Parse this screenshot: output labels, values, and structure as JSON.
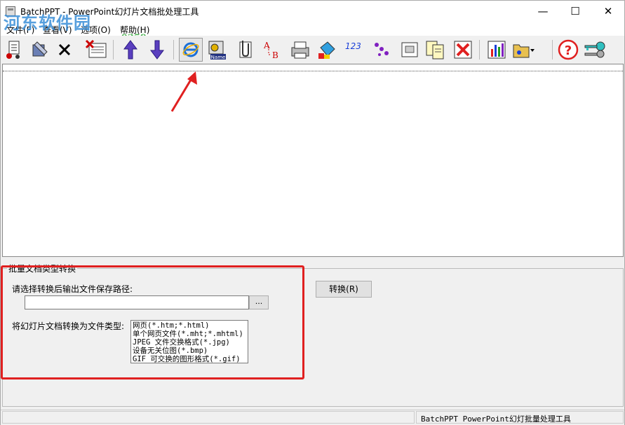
{
  "window": {
    "title": "BatchPPT - PowerPoint幻灯片文档批处理工具",
    "min_glyph": "—",
    "max_glyph": "☐",
    "close_glyph": "✕"
  },
  "watermark": {
    "text": "河东软件园",
    "url": "www.pc0359.cn"
  },
  "menu": {
    "items": [
      "文件(F)",
      "查看(V)",
      "选项(O)",
      "帮助(H)"
    ]
  },
  "toolbar": {
    "icons": [
      "open-files-icon",
      "edit-settings-icon",
      "delete-x-icon",
      "delete-list-icon",
      "move-up-icon",
      "move-down-icon",
      "ie-html-icon",
      "rename-icon",
      "attach-icon",
      "replace-ab-icon",
      "print-icon",
      "fill-icon",
      "numbering-icon",
      "path-dots-icon",
      "slide-icon",
      "copy-docs-icon",
      "remove-red-x-icon",
      "chart-icon",
      "folder-dropdown-icon",
      "help-icon",
      "key-icon"
    ],
    "numbering_text": "123",
    "replace_text": "AB",
    "rename_text": "Name"
  },
  "panel": {
    "group_title": "批量文档类型转换",
    "path_label": "请选择转换后输出文件保存路径:",
    "path_value": "",
    "browse_label": "...",
    "convert_label": "转换(R)",
    "type_label": "将幻灯片文档转换为文件类型:",
    "types": [
      "网页(*.htm;*.html)",
      "单个网页文件(*.mht;*.mhtml)",
      "JPEG 文件交换格式(*.jpg)",
      "设备无关位图(*.bmp)",
      "GIF 可交换的图形格式(*.gif)"
    ]
  },
  "status": {
    "text": "BatchPPT PowerPoint幻灯批量处理工具"
  },
  "colors": {
    "annotation_red": "#e02020",
    "watermark_blue": "#3a8fd8",
    "watermark_green": "#3cb043"
  }
}
